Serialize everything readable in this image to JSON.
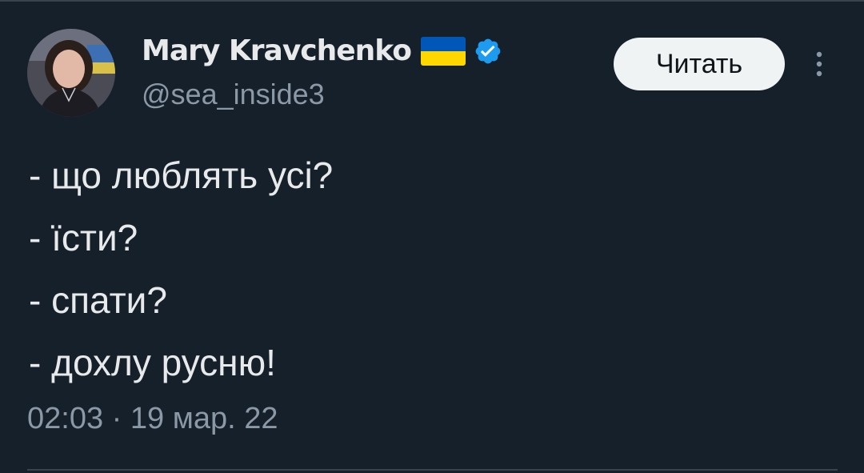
{
  "author": {
    "display_name": "Mary Kravchenko",
    "handle": "@sea_inside3",
    "verified": true,
    "flag": "ukraine-flag"
  },
  "follow_button": {
    "label": "Читать"
  },
  "tweet": {
    "lines": [
      "- що люблять усі?",
      "- їсти?",
      "- спати?",
      "- дохлу русню!"
    ],
    "timestamp": "02:03 · 19 мар. 22"
  },
  "colors": {
    "background": "#15202b",
    "text_primary": "#e7e9ea",
    "text_secondary": "#8b98a5",
    "verified_blue": "#1d9bf0",
    "flag_blue": "#0057b7",
    "flag_yellow": "#ffd700",
    "button_bg": "#eff3f4",
    "divider": "#38444d"
  },
  "icons": [
    "avatar",
    "ukraine-flag-icon",
    "verified-badge-icon",
    "more-options-icon"
  ]
}
